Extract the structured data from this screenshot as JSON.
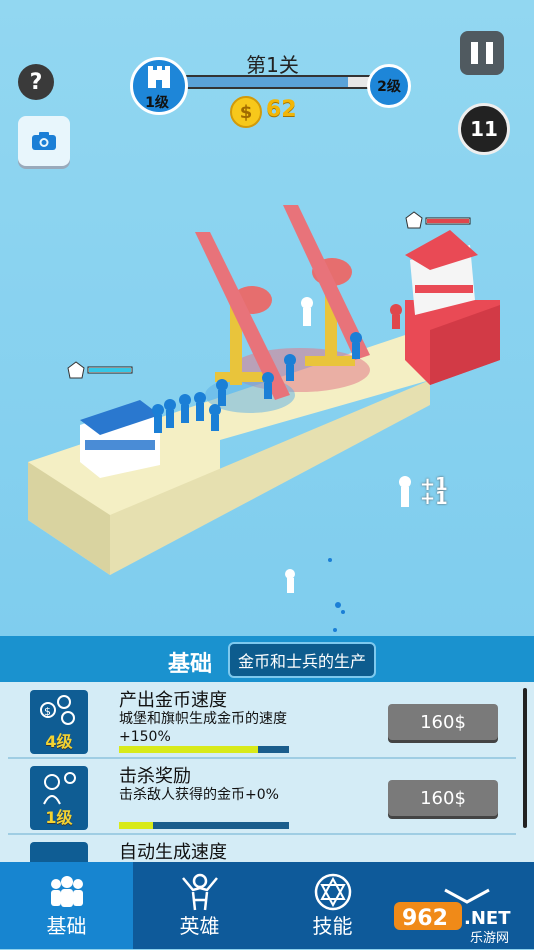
{
  "hud": {
    "level_title": "第1关",
    "level_from": "1级",
    "level_to": "2级",
    "level_progress": 0.85,
    "coins": "62",
    "coin_symbol": "$",
    "timer": "11",
    "help": "?",
    "floating_bonus_1": "+1",
    "floating_bonus_2": "+1"
  },
  "panel": {
    "title": "基础",
    "subtitle": "金币和士兵的生产",
    "upgrades": [
      {
        "name": "产出金币速度",
        "desc": "城堡和旗帜生成金币的速度+150%",
        "level": "4级",
        "price": "160$",
        "progress": 0.82,
        "icon": "coins-icon"
      },
      {
        "name": "击杀奖励",
        "desc": "击杀敌人获得的金币+0%",
        "level": "1级",
        "price": "160$",
        "progress": 0.2,
        "icon": "head-coins-icon"
      },
      {
        "name": "自动生成速度",
        "desc": "",
        "level": "",
        "price": "",
        "progress": 0,
        "icon": "auto-icon"
      }
    ]
  },
  "tabs": [
    {
      "label": "基础",
      "icon": "crowd-icon",
      "active": true
    },
    {
      "label": "英雄",
      "icon": "hero-icon",
      "active": false
    },
    {
      "label": "技能",
      "icon": "star-icon",
      "active": false
    },
    {
      "label": "",
      "icon": "plane-icon",
      "active": false
    }
  ],
  "watermark": {
    "brand": "962",
    "domain": ".NET",
    "sub": "乐游网"
  },
  "colors": {
    "player": "#1b7fd6",
    "enemy": "#e0474c",
    "accent": "#1a92cf"
  }
}
